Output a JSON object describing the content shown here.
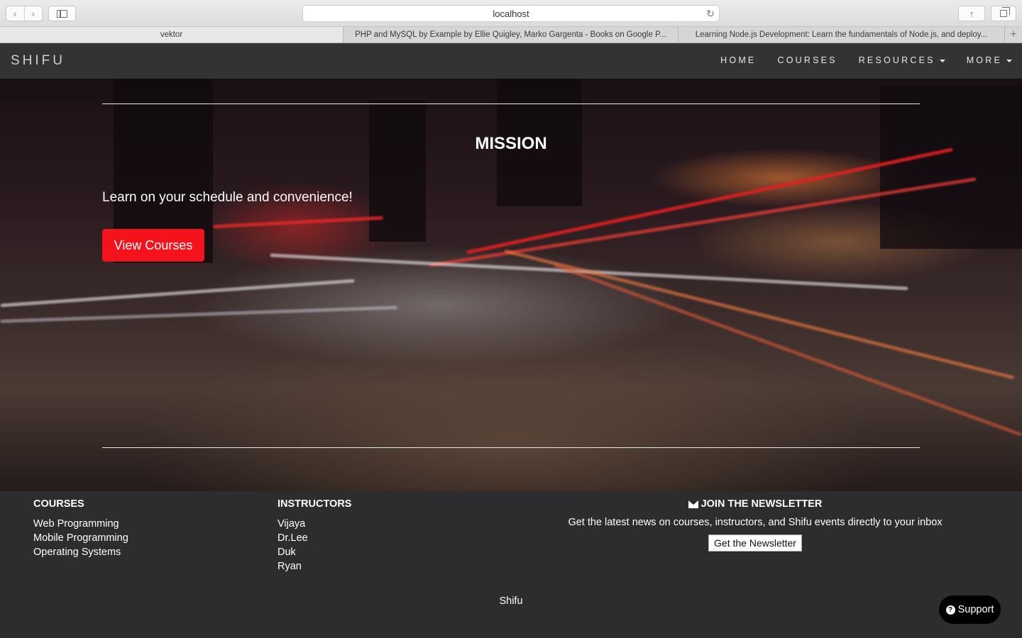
{
  "browser": {
    "address": "localhost",
    "tabs": [
      {
        "label": "vektor",
        "active": true
      },
      {
        "label": "PHP and MySQL by Example by Ellie Quigley, Marko Gargenta - Books on Google P...",
        "active": false
      },
      {
        "label": "Learning Node.js Development: Learn the fundamentals of Node.js, and deploy...",
        "active": false
      }
    ],
    "icons": [
      "back-icon",
      "forward-icon",
      "sidebar-icon",
      "reload-icon",
      "share-icon",
      "tabs-overview-icon",
      "new-tab-icon"
    ]
  },
  "nav": {
    "brand": "SHIFU",
    "items": [
      {
        "label": "HOME",
        "dropdown": false
      },
      {
        "label": "COURSES",
        "dropdown": false
      },
      {
        "label": "RESOURCES",
        "dropdown": true
      },
      {
        "label": "MORE",
        "dropdown": true
      }
    ]
  },
  "hero": {
    "title": "MISSION",
    "tagline": "Learn on your schedule and convenience!",
    "cta_label": "View Courses",
    "cta_color": "#f4121c"
  },
  "footer": {
    "courses": {
      "heading": "COURSES",
      "links": [
        "Web Programming",
        "Mobile Programming",
        "Operating Systems"
      ]
    },
    "instructors": {
      "heading": "INSTRUCTORS",
      "links": [
        "Vijaya",
        "Dr.Lee",
        "Duk",
        "Ryan"
      ]
    },
    "newsletter": {
      "heading": "JOIN THE NEWSLETTER",
      "text": "Get the latest news on courses, instructors, and Shifu events directly to your inbox",
      "button_label": "Get the Newsletter"
    },
    "copyright": "Shifu",
    "support_label": "Support"
  }
}
